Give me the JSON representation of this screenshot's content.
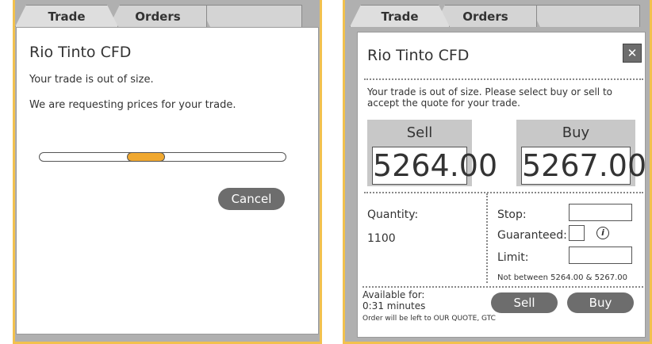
{
  "left_panel": {
    "tabs": [
      {
        "label": "Trade"
      },
      {
        "label": "Orders"
      }
    ],
    "title": "Rio Tinto CFD",
    "message1": "Your trade is out of size.",
    "message2": "We are requesting prices for your trade.",
    "cancel_label": "Cancel"
  },
  "right_panel": {
    "tabs": [
      {
        "label": "Trade"
      },
      {
        "label": "Orders"
      }
    ],
    "title": "Rio Tinto CFD",
    "message": "Your trade is out of size. Please select buy or sell to accept the quote for your trade.",
    "sell": {
      "label": "Sell",
      "price": "5264.00"
    },
    "buy": {
      "label": "Buy",
      "price": "5267.00"
    },
    "quantity_label": "Quantity:",
    "quantity_value": "1100",
    "stop_label": "Stop:",
    "guaranteed_label": "Guaranteed:",
    "limit_label": "Limit:",
    "range_note": "Not between 5264.00 & 5267.00",
    "available_label": "Available for:",
    "available_time": "0:31 minutes",
    "order_note": "Order will be left to OUR QUOTE, GTC",
    "sell_button": "Sell",
    "buy_button": "Buy",
    "info_glyph": "i",
    "close_glyph": "✕"
  },
  "colors": {
    "accent": "#f2c14e",
    "progress": "#f0a830",
    "button": "#6d6d6d"
  }
}
